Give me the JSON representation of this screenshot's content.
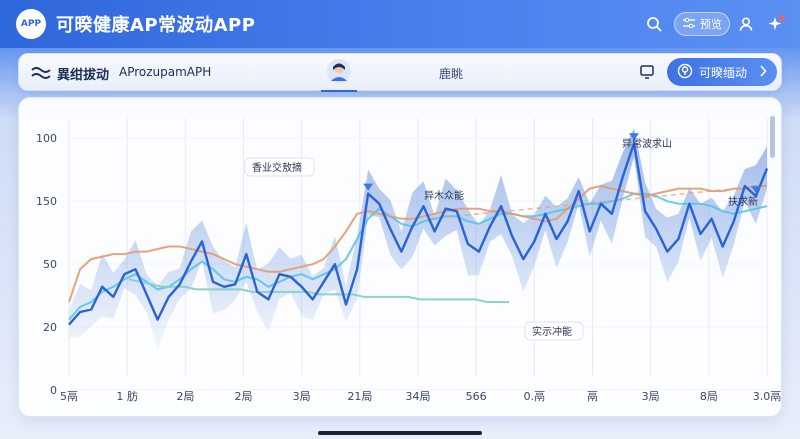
{
  "header": {
    "badge": "APP",
    "title": "可暌健康AP常波动APP",
    "preview_label": "预览",
    "icons": [
      "search-icon",
      "filter-icon",
      "user-icon",
      "sparkle-icon"
    ]
  },
  "toolbar": {
    "title": "異绀拔动",
    "subtitle": "AProzupamAPH",
    "tab2_label": "鹿眺",
    "action_label": "可暌缅动",
    "icons": [
      "waves-icon",
      "avatar-icon",
      "screen-icon",
      "pin-icon",
      "chevron-right-icon"
    ]
  },
  "colors": {
    "accent": "#2f67dc",
    "series_main": "#2a63d6",
    "series_fill": "#7ea3e4",
    "series_cyan": "#4fc3e6",
    "series_orange": "#e39a6e",
    "series_teal": "#7fcfc4"
  },
  "chart_data": {
    "type": "line",
    "y_ticks": [
      "100",
      "150",
      "50",
      "20",
      "0"
    ],
    "x_ticks": [
      "5鬲",
      "1 肪",
      "2局",
      "2局",
      "3局",
      "21局",
      "34局",
      "566",
      "0.鬲",
      "鬲",
      "3局",
      "8局",
      "3.0鬲"
    ],
    "annotations": [
      {
        "text": "香业交敖摘",
        "x_index": 2
      },
      {
        "text": "异木众能",
        "x_index": 6
      },
      {
        "text": "异常波求山",
        "x_index": 10
      },
      {
        "text": "扶求新",
        "x_index": 12
      },
      {
        "text": "实示冲能",
        "x_index": 8
      }
    ],
    "series": [
      {
        "values": [
          18,
          23,
          24,
          33,
          29,
          38,
          40,
          30,
          20,
          29,
          34,
          43,
          51,
          35,
          33,
          34,
          46,
          31,
          28,
          38,
          37,
          33,
          28,
          35,
          42,
          26,
          40,
          70,
          66,
          56,
          47,
          57,
          65,
          55,
          64,
          63,
          50,
          47,
          57,
          65,
          53,
          44,
          51,
          62,
          52,
          59,
          71,
          55,
          66,
          62,
          77,
          90,
          63,
          56,
          47,
          52,
          66,
          54,
          60,
          49,
          59,
          73,
          69,
          80
        ]
      },
      {
        "values": [
          20,
          25,
          27,
          31,
          33,
          36,
          38,
          35,
          32,
          33,
          36,
          40,
          43,
          40,
          36,
          35,
          37,
          36,
          33,
          35,
          37,
          38,
          36,
          38,
          40,
          44,
          52,
          60,
          64,
          61,
          58,
          57,
          59,
          60,
          61,
          61,
          59,
          58,
          60,
          62,
          62,
          61,
          61,
          62,
          63,
          64,
          65,
          66,
          66,
          67,
          68,
          70,
          70,
          69,
          67,
          66,
          66,
          66,
          65,
          63,
          62,
          63,
          64,
          65
        ]
      },
      {
        "values": [
          27,
          40,
          44,
          45,
          46,
          46,
          47,
          47,
          48,
          49,
          49,
          48,
          47,
          46,
          44,
          42,
          41,
          40,
          39,
          39,
          40,
          41,
          42,
          44,
          49,
          55,
          62,
          63,
          62,
          61,
          60,
          60,
          61,
          62,
          63,
          64,
          64,
          64,
          63,
          63,
          62,
          61,
          60,
          59,
          60,
          64,
          68,
          72,
          73,
          72,
          71,
          70,
          69,
          70,
          71,
          72,
          72,
          72,
          71,
          71,
          72,
          72,
          73,
          73
        ]
      },
      {
        "values": [
          36,
          35,
          34,
          33,
          33,
          33,
          32,
          32,
          32,
          32,
          32,
          31,
          31,
          31,
          31,
          31,
          31,
          30,
          30,
          30,
          30,
          29,
          29,
          29,
          29,
          29,
          28,
          28,
          28,
          28,
          28,
          28,
          27,
          27,
          27
        ]
      }
    ]
  }
}
